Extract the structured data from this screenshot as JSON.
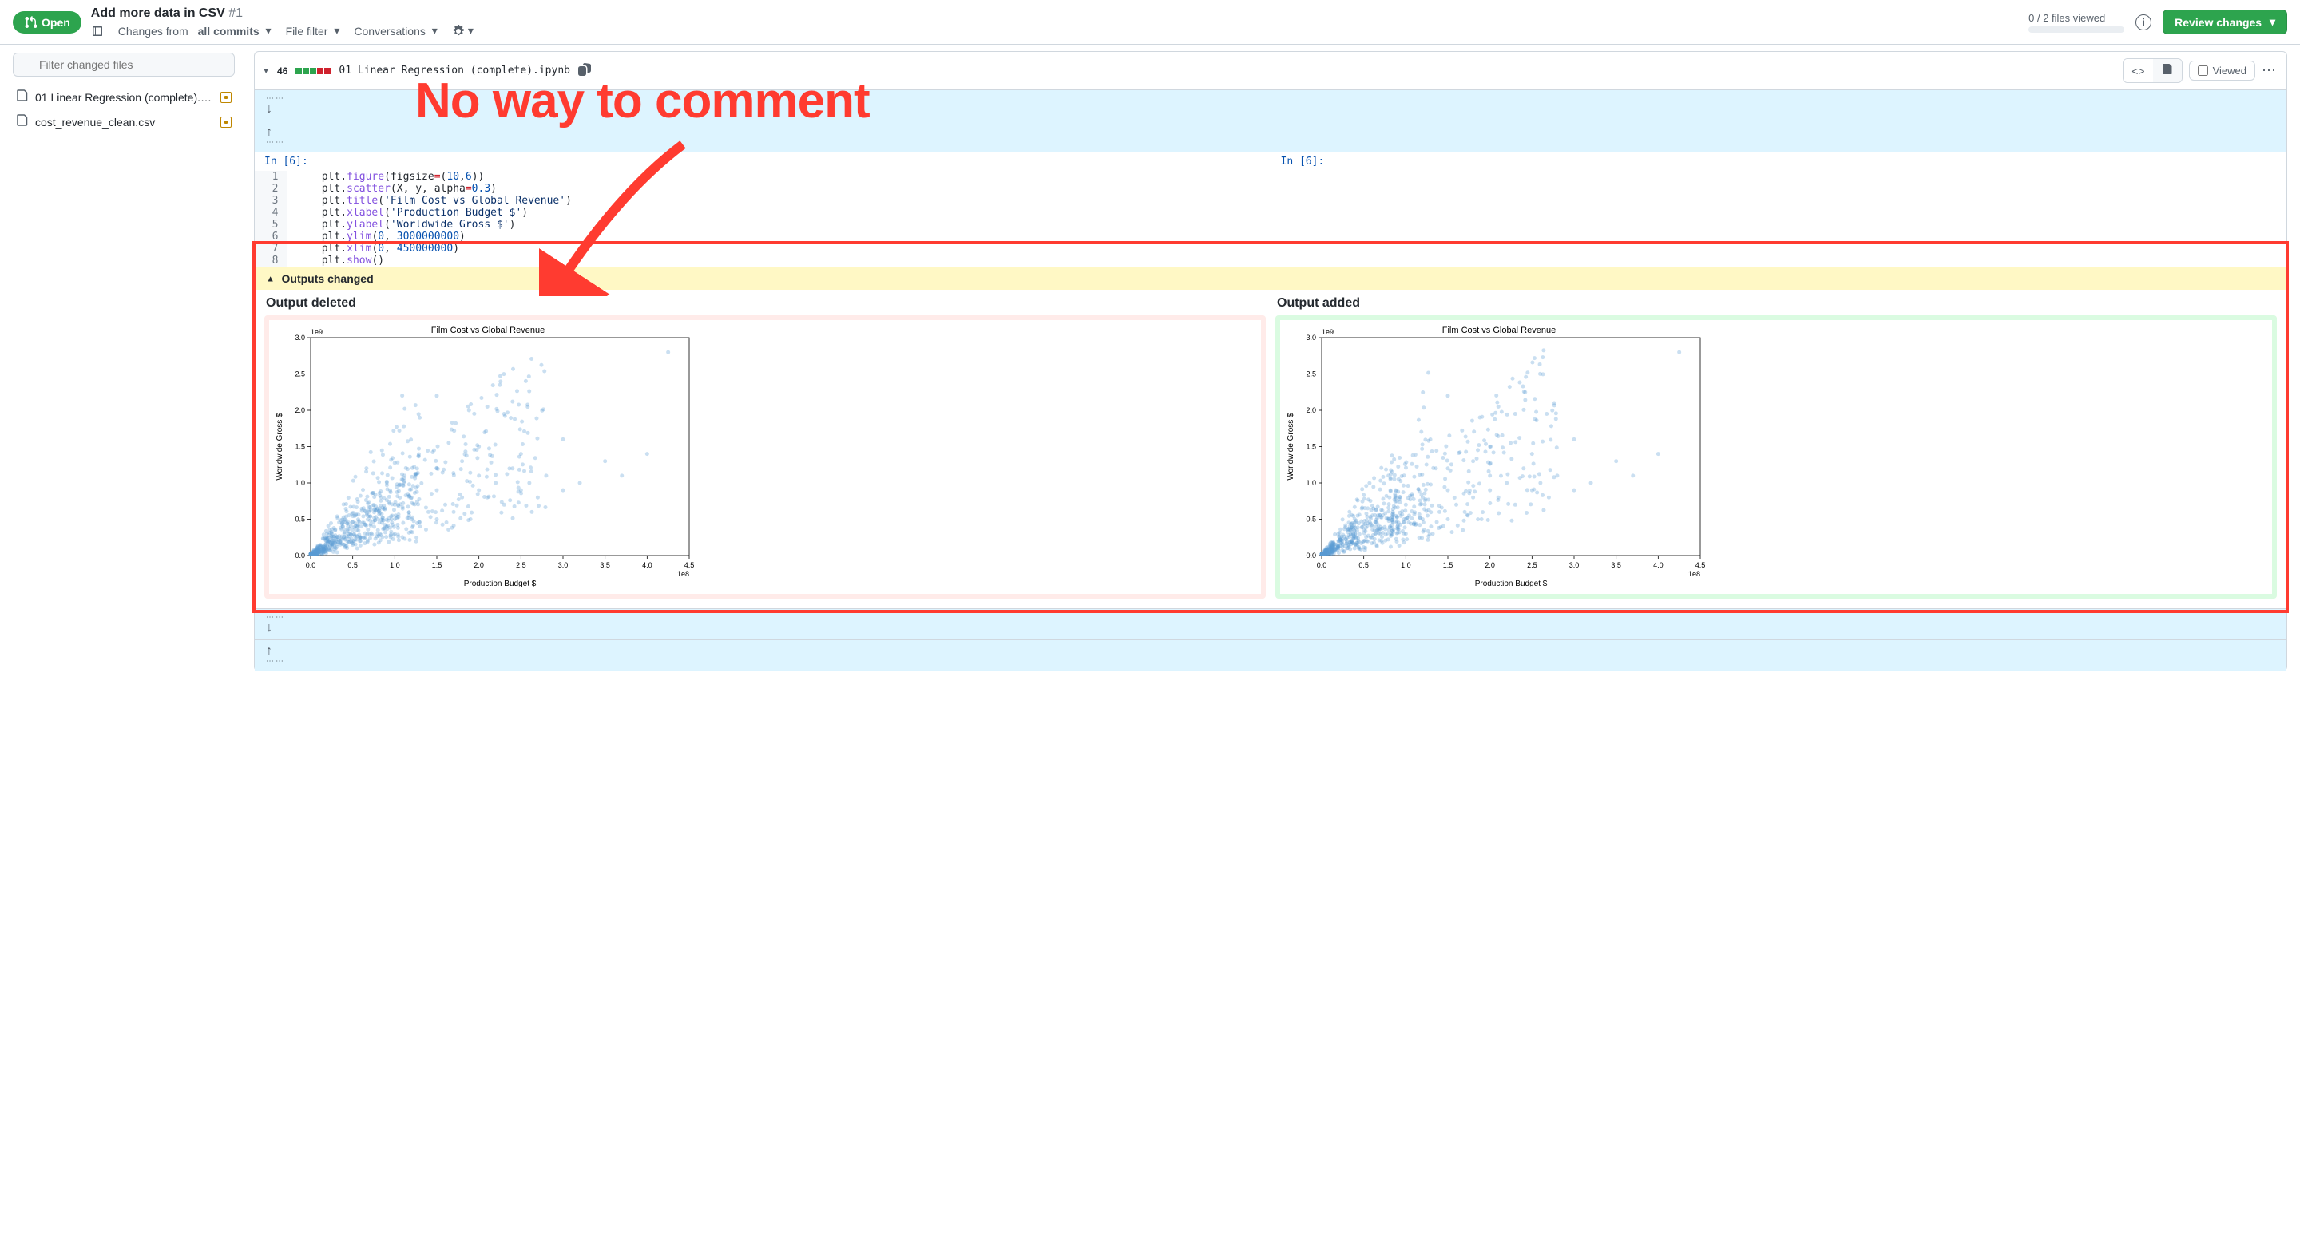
{
  "header": {
    "status": "Open",
    "title": "Add more data in CSV",
    "number": "#1",
    "changes_from": "Changes from",
    "all_commits": "all commits",
    "file_filter": "File filter",
    "conversations": "Conversations",
    "files_viewed": "0 / 2 files viewed",
    "review_btn": "Review changes"
  },
  "sidebar": {
    "filter_placeholder": "Filter changed files",
    "files": [
      {
        "name": "01 Linear Regression (complete).i…"
      },
      {
        "name": "cost_revenue_clean.csv"
      }
    ]
  },
  "file": {
    "diff_count": "46",
    "name": "01 Linear Regression (complete).ipynb",
    "viewed_label": "Viewed",
    "cell_label_left": "In [6]:",
    "cell_label_right": "In [6]:",
    "code_lines": [
      {
        "n": "1",
        "html": "plt.<span class='tok-f'>figure</span>(figsize<span class='tok-op'>=</span>(<span class='tok-n'>10</span>,<span class='tok-n'>6</span>))"
      },
      {
        "n": "2",
        "html": "plt.<span class='tok-f'>scatter</span>(X, y, alpha<span class='tok-op'>=</span><span class='tok-n'>0.3</span>)"
      },
      {
        "n": "3",
        "html": "plt.<span class='tok-f'>title</span>(<span class='tok-s'>'Film Cost vs Global Revenue'</span>)"
      },
      {
        "n": "4",
        "html": "plt.<span class='tok-f'>xlabel</span>(<span class='tok-s'>'Production Budget $'</span>)"
      },
      {
        "n": "5",
        "html": "plt.<span class='tok-f'>ylabel</span>(<span class='tok-s'>'Worldwide Gross $'</span>)"
      },
      {
        "n": "6",
        "html": "plt.<span class='tok-f'>ylim</span>(<span class='tok-n'>0</span>, <span class='tok-n'>3000000000</span>)"
      },
      {
        "n": "7",
        "html": "plt.<span class='tok-f'>xlim</span>(<span class='tok-n'>0</span>, <span class='tok-n'>450000000</span>)"
      },
      {
        "n": "8",
        "html": "plt.<span class='tok-f'>show</span>()"
      }
    ],
    "outputs_changed": "Outputs changed",
    "output_deleted": "Output deleted",
    "output_added": "Output added"
  },
  "annotation": {
    "text": "No way to comment"
  },
  "chart_data": {
    "type": "scatter",
    "title": "Film Cost vs Global Revenue",
    "xlabel": "Production Budget $",
    "ylabel": "Worldwide Gross $",
    "xlim": [
      0,
      450000000.0
    ],
    "ylim": [
      0,
      3000000000.0
    ],
    "x_exponent": "1e8",
    "y_exponent": "1e9",
    "x_ticks": [
      0.0,
      0.5,
      1.0,
      1.5,
      2.0,
      2.5,
      3.0,
      3.5,
      4.0,
      4.5
    ],
    "y_ticks": [
      0.0,
      0.5,
      1.0,
      1.5,
      2.0,
      2.5,
      3.0
    ],
    "note": "Dense positively-correlated scatter; hundreds of points clustered near origin, spreading toward higher budget/gross. Both deleted and added charts appear visually identical.",
    "sample_points_e8_e9": [
      [
        0.1,
        0.05
      ],
      [
        0.1,
        0.1
      ],
      [
        0.15,
        0.08
      ],
      [
        0.2,
        0.12
      ],
      [
        0.2,
        0.2
      ],
      [
        0.25,
        0.15
      ],
      [
        0.3,
        0.1
      ],
      [
        0.3,
        0.25
      ],
      [
        0.35,
        0.2
      ],
      [
        0.4,
        0.3
      ],
      [
        0.4,
        0.15
      ],
      [
        0.5,
        0.2
      ],
      [
        0.5,
        0.35
      ],
      [
        0.6,
        0.25
      ],
      [
        0.6,
        0.4
      ],
      [
        0.7,
        0.3
      ],
      [
        0.8,
        0.35
      ],
      [
        0.8,
        0.5
      ],
      [
        0.9,
        0.4
      ],
      [
        1.0,
        0.3
      ],
      [
        1.0,
        0.5
      ],
      [
        1.0,
        0.7
      ],
      [
        1.1,
        0.45
      ],
      [
        1.2,
        0.5
      ],
      [
        1.2,
        0.8
      ],
      [
        1.3,
        0.4
      ],
      [
        1.4,
        0.6
      ],
      [
        1.5,
        0.5
      ],
      [
        1.5,
        0.9
      ],
      [
        1.5,
        1.2
      ],
      [
        1.6,
        0.7
      ],
      [
        1.7,
        0.6
      ],
      [
        1.8,
        0.8
      ],
      [
        1.8,
        1.3
      ],
      [
        1.9,
        0.5
      ],
      [
        2.0,
        0.9
      ],
      [
        2.0,
        1.1
      ],
      [
        2.0,
        1.5
      ],
      [
        2.1,
        0.8
      ],
      [
        2.2,
        1.0
      ],
      [
        2.3,
        0.7
      ],
      [
        2.4,
        1.2
      ],
      [
        2.5,
        0.9
      ],
      [
        2.5,
        1.4
      ],
      [
        2.6,
        1.0
      ],
      [
        2.7,
        0.8
      ],
      [
        2.8,
        1.1
      ],
      [
        3.0,
        0.9
      ],
      [
        3.0,
        1.6
      ],
      [
        3.2,
        1.0
      ],
      [
        3.5,
        1.3
      ],
      [
        3.7,
        1.1
      ],
      [
        4.0,
        1.4
      ],
      [
        4.25,
        2.8
      ],
      [
        1.5,
        2.2
      ],
      [
        2.1,
        2.05
      ],
      [
        2.3,
        1.95
      ]
    ]
  }
}
